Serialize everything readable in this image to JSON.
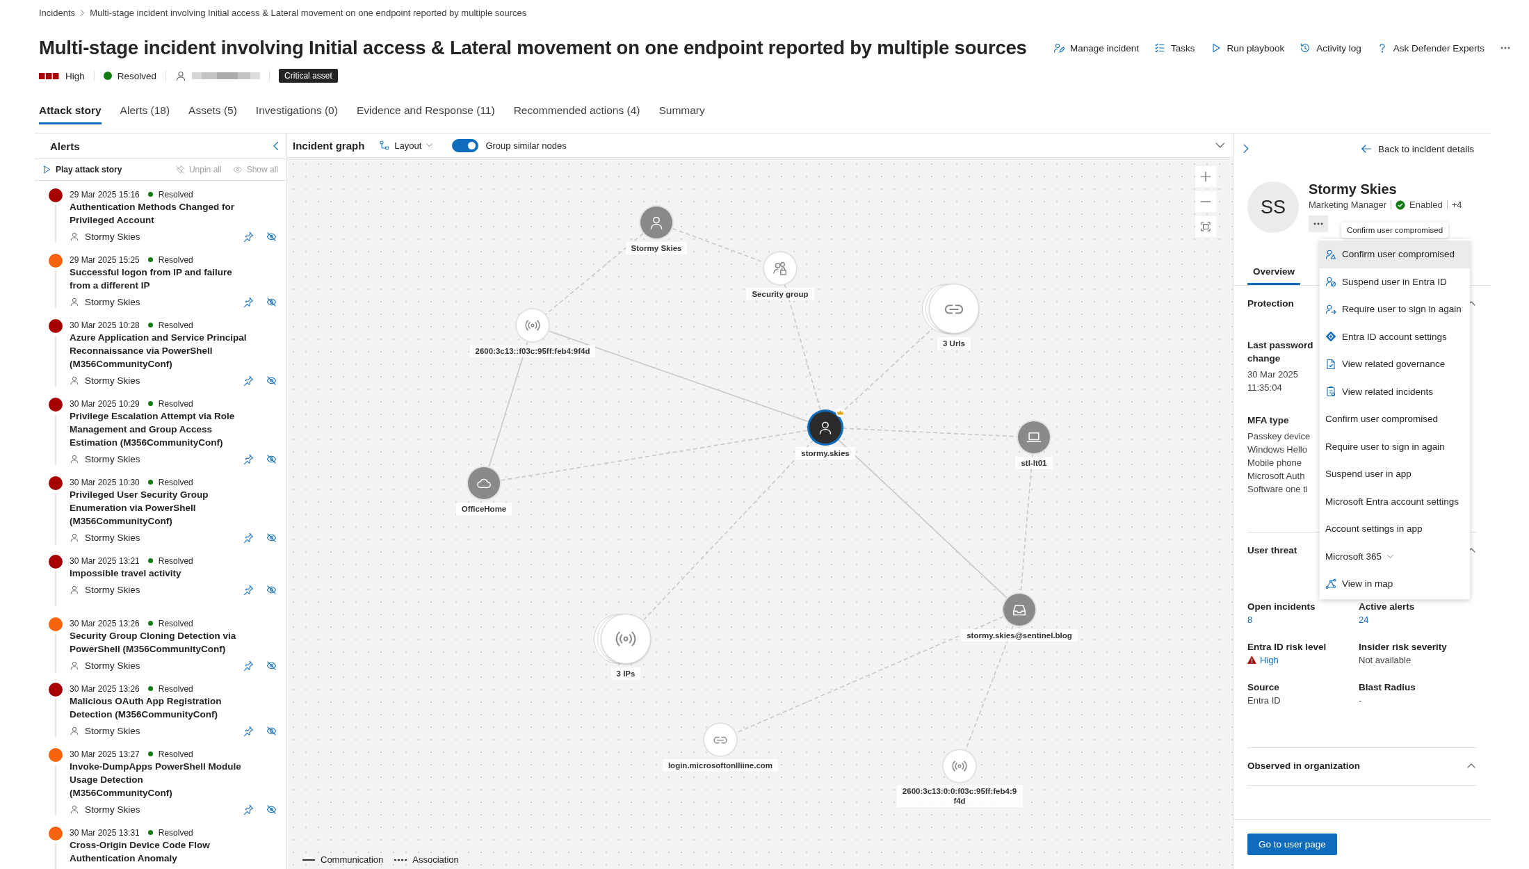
{
  "breadcrumb": [
    {
      "label": "Incidents"
    },
    {
      "label": "Multi-stage incident involving Initial access & Lateral movement on one endpoint reported by multiple sources"
    }
  ],
  "title": "Multi-stage incident involving Initial access & Lateral movement on one endpoint reported by multiple sources",
  "actions": [
    {
      "label": "Manage incident"
    },
    {
      "label": "Tasks"
    },
    {
      "label": "Run playbook"
    },
    {
      "label": "Activity log"
    },
    {
      "label": "Ask Defender Experts"
    }
  ],
  "meta": {
    "severity": {
      "label": "High",
      "kind": "high"
    },
    "status": {
      "label": "Resolved",
      "kind": "resolved"
    },
    "tag": "Critical asset"
  },
  "tabs": [
    {
      "label": "Attack story",
      "selected": true
    },
    {
      "label": "Alerts (18)",
      "selected": false
    },
    {
      "label": "Assets (5)",
      "selected": false
    },
    {
      "label": "Investigations (0)",
      "selected": false
    },
    {
      "label": "Evidence and Response (11)",
      "selected": false
    },
    {
      "label": "Recommended actions (4)",
      "selected": false
    },
    {
      "label": "Summary",
      "selected": false
    }
  ],
  "alerts_panel": {
    "title": "Alerts",
    "controls": [
      {
        "label": "Play attack story",
        "disabled": false
      },
      {
        "label": "Unpin all",
        "disabled": true
      },
      {
        "label": "Show all",
        "disabled": true
      }
    ],
    "alerts": [
      {
        "color": "#a80000",
        "time": "29 Mar 2025 15:16",
        "status": "Resolved",
        "title": "Authentication Methods Changed for Privileged Account",
        "user": "Stormy Skies"
      },
      {
        "color": "#f7630c",
        "time": "29 Mar 2025 15:25",
        "status": "Resolved",
        "title": "Successful logon from IP and failure from a different IP",
        "user": "Stormy Skies"
      },
      {
        "color": "#a80000",
        "time": "30 Mar 2025 10:28",
        "status": "Resolved",
        "title": "Azure Application and Service Principal Reconnaissance via PowerShell (M356CommunityConf)",
        "user": "Stormy Skies"
      },
      {
        "color": "#a80000",
        "time": "30 Mar 2025 10:29",
        "status": "Resolved",
        "title": "Privilege Escalation Attempt via Role Management and Group Access Estimation (M356CommunityConf)",
        "user": "Stormy Skies"
      },
      {
        "color": "#a80000",
        "time": "30 Mar 2025 10:30",
        "status": "Resolved",
        "title": "Privileged User Security Group Enumeration via PowerShell (M356CommunityConf)",
        "user": "Stormy Skies"
      },
      {
        "color": "#a80000",
        "time": "30 Mar 2025 13:21",
        "status": "Resolved",
        "title": "Impossible travel activity",
        "user": "Stormy Skies"
      },
      {
        "color": "#f7630c",
        "time": "30 Mar 2025 13:26",
        "status": "Resolved",
        "title": "Security Group Cloning Detection via PowerShell (M356CommunityConf)",
        "user": "Stormy Skies"
      },
      {
        "color": "#a80000",
        "time": "30 Mar 2025 13:26",
        "status": "Resolved",
        "title": "Malicious OAuth App Registration Detection (M356CommunityConf)",
        "user": "Stormy Skies"
      },
      {
        "color": "#f7630c",
        "time": "30 Mar 2025 13:27",
        "status": "Resolved",
        "title": "Invoke-DumpApps PowerShell Module Usage Detection (M356CommunityConf)",
        "user": "Stormy Skies"
      },
      {
        "color": "#f7630c",
        "time": "30 Mar 2025 13:31",
        "status": "Resolved",
        "title": "Cross-Origin Device Code Flow Authentication Anomaly"
      }
    ]
  },
  "graph": {
    "title": "Incident graph",
    "layout": "Layout",
    "group_toggle": {
      "label": "Group similar nodes",
      "on": true
    },
    "nodes": [
      {
        "label": "Stormy Skies",
        "kind": "user",
        "stacked": false,
        "selected": false,
        "critical": false
      },
      {
        "label": "Security group",
        "kind": "group",
        "stacked": false,
        "selected": false,
        "critical": false
      },
      {
        "label": "3 Urls",
        "kind": "url",
        "stacked": true,
        "selected": false,
        "critical": false
      },
      {
        "label": "2600:3c13::f03c:95ff:feb4:9f4d",
        "kind": "ip",
        "stacked": false,
        "selected": false,
        "critical": false
      },
      {
        "label": "stormy.skies",
        "kind": "user",
        "stacked": false,
        "selected": true,
        "critical": true
      },
      {
        "label": "stl-lt01",
        "kind": "device",
        "stacked": false,
        "selected": false,
        "critical": false
      },
      {
        "label": "OfficeHome",
        "kind": "cloud",
        "stacked": false,
        "selected": false,
        "critical": false
      },
      {
        "label": "3 IPs",
        "kind": "ip",
        "stacked": true,
        "selected": false,
        "critical": false
      },
      {
        "label": "stormy.skies@sentinel.blog",
        "kind": "mailbox",
        "stacked": false,
        "selected": false,
        "critical": false
      },
      {
        "label": "login.microsoftonlliine.com",
        "kind": "url",
        "stacked": false,
        "selected": false,
        "critical": false
      },
      {
        "label": "2600:3c13:0:0:f03c:95ff:feb4:9f4d",
        "kind": "ip",
        "stacked": false,
        "selected": false,
        "critical": false
      }
    ],
    "legend": [
      {
        "label": "Communication",
        "kind": "solid"
      },
      {
        "label": "Association",
        "kind": "dashed"
      }
    ]
  },
  "entity_panel": {
    "back": "Back to incident details",
    "initials": "SS",
    "name": "Stormy Skies",
    "job": "Marketing Manager",
    "account_status": {
      "label": "Enabled",
      "kind": "enabled"
    },
    "more": "+4",
    "tooltip": "Confirm user compromised",
    "menu": [
      {
        "label": "Confirm user compromised",
        "kind": "icon",
        "selected": true
      },
      {
        "label": "Suspend user in Entra ID",
        "kind": "icon",
        "selected": false
      },
      {
        "label": "Require user to sign in again",
        "kind": "icon",
        "selected": false
      },
      {
        "label": "Entra ID account settings",
        "kind": "icon",
        "selected": false
      },
      {
        "label": "View related governance",
        "kind": "icon",
        "selected": false
      },
      {
        "label": "View related incidents",
        "kind": "icon",
        "selected": false
      },
      {
        "label": "Confirm user compromised",
        "kind": "text",
        "selected": false
      },
      {
        "label": "Require user to sign in again",
        "kind": "text",
        "selected": false
      },
      {
        "label": "Suspend user in app",
        "kind": "text",
        "selected": false
      },
      {
        "label": "Microsoft Entra account settings",
        "kind": "text",
        "selected": false
      },
      {
        "label": "Account settings in app",
        "kind": "text",
        "selected": false
      },
      {
        "label": "Microsoft 365",
        "kind": "submenu",
        "selected": false
      },
      {
        "label": "View in map",
        "kind": "icon",
        "selected": false
      }
    ],
    "tabs": [
      {
        "label": "Overview",
        "selected": true
      }
    ],
    "protection": {
      "title": "Protection",
      "expanded": true,
      "password_label": "Last password change",
      "password_value": "30 Mar 2025 11:35:04",
      "mfa_label": "MFA type",
      "mfa_values": [
        "Passkey device",
        "Windows Hello",
        "Mobile phone",
        "Microsoft Auth",
        "Software one ti"
      ]
    },
    "user_threat": {
      "title": "User threat",
      "expanded": true,
      "fields": [
        {
          "label": "Open incidents",
          "value": "8",
          "kind": "link"
        },
        {
          "label": "Active alerts",
          "value": "24",
          "kind": "link"
        },
        {
          "label": "Entra ID risk level",
          "value": "High",
          "kind": "risk"
        },
        {
          "label": "Insider risk severity",
          "value": "Not available",
          "kind": "text"
        },
        {
          "label": "Source",
          "value": "Entra ID",
          "kind": "text"
        },
        {
          "label": "Blast Radius",
          "value": "-",
          "kind": "text"
        }
      ]
    },
    "observed": {
      "title": "Observed in organization",
      "expanded": true
    },
    "primary_button": "Go to user page"
  }
}
